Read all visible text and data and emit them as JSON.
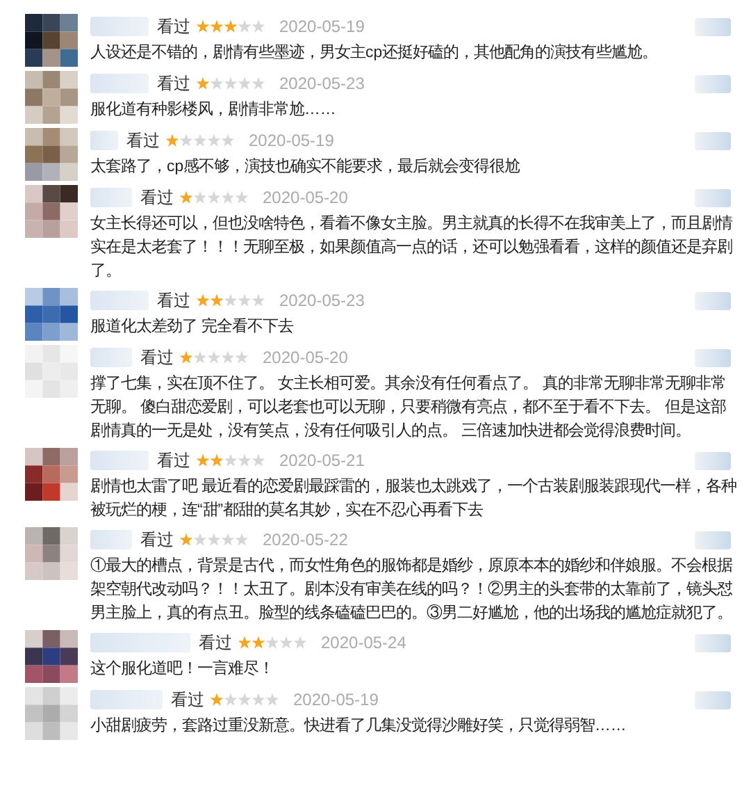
{
  "comments": [
    {
      "status": "看过",
      "stars": 3,
      "date": "2020-05-19",
      "text": "人设还是不错的，剧情有些墨迹，男女主cp还挺好磕的，其他配角的演技有些尴尬。"
    },
    {
      "status": "看过",
      "stars": 1,
      "date": "2020-05-23",
      "text": "服化道有种影楼风，剧情非常尬……"
    },
    {
      "status": "看过",
      "stars": 1,
      "date": "2020-05-19",
      "text": "太套路了，cp感不够，演技也确实不能要求，最后就会变得很尬"
    },
    {
      "status": "看过",
      "stars": 1,
      "date": "2020-05-20",
      "text": "女主长得还可以，但也没啥特色，看着不像女主脸。男主就真的长得不在我审美上了，而且剧情实在是太老套了！！！无聊至极，如果颜值高一点的话，还可以勉强看看，这样的颜值还是弃剧了。"
    },
    {
      "status": "看过",
      "stars": 2,
      "date": "2020-05-23",
      "text": "服道化太差劲了 完全看不下去"
    },
    {
      "status": "看过",
      "stars": 1,
      "date": "2020-05-20",
      "text": "撑了七集，实在顶不住了。 女主长相可爱。其余没有任何看点了。 真的非常无聊非常无聊非常无聊。 傻白甜恋爱剧，可以老套也可以无聊，只要稍微有亮点，都不至于看不下去。 但是这部剧情真的一无是处，没有笑点，没有任何吸引人的点。 三倍速加快进都会觉得浪费时间。"
    },
    {
      "status": "看过",
      "stars": 2,
      "date": "2020-05-21",
      "text": "剧情也太雷了吧 最近看的恋爱剧最踩雷的，服装也太跳戏了，一个古装剧服装跟现代一样，各种被玩烂的梗，连“甜”都甜的莫名其妙，实在不忍心再看下去"
    },
    {
      "status": "看过",
      "stars": 1,
      "date": "2020-05-22",
      "text": "①最大的槽点，背景是古代，而女性角色的服饰都是婚纱，原原本本的婚纱和伴娘服。不会根据架空朝代改动吗？！！太丑了。剧本没有审美在线的吗？！②男主的头套带的太靠前了，镜头怼男主脸上，真的有点丑。脸型的线条磕磕巴巴的。③男二好尴尬，他的出场我的尴尬症就犯了。"
    },
    {
      "status": "看过",
      "stars": 2,
      "date": "2020-05-24",
      "text": "这个服化道吧！一言难尽！"
    },
    {
      "status": "看过",
      "stars": 1,
      "date": "2020-05-19",
      "text": "小甜剧疲劳，套路过重没新意。快进看了几集没觉得沙雕好笑，只觉得弱智……"
    }
  ]
}
